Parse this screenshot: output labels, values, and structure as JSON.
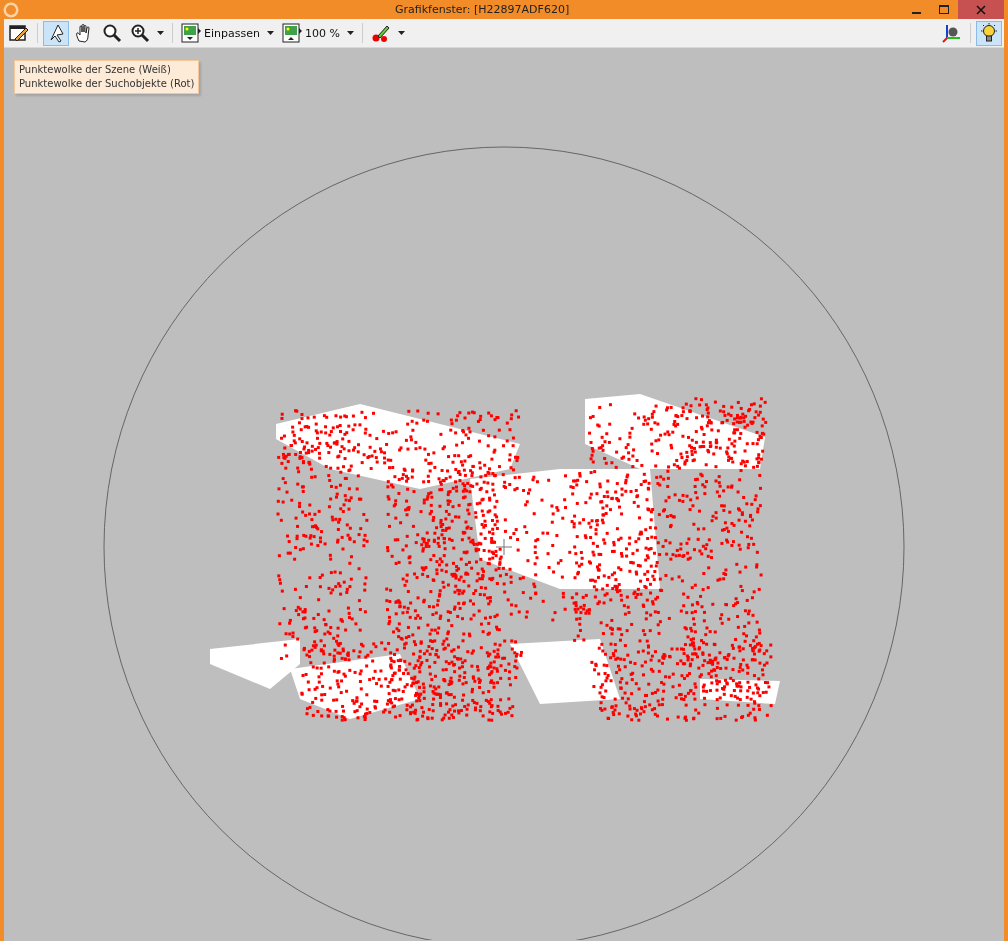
{
  "window": {
    "title": "Grafikfenster: [H22897ADF620]"
  },
  "toolbar": [
    {
      "kind": "edit",
      "selected": false,
      "dropdown": false
    },
    {
      "kind": "separator"
    },
    {
      "kind": "pointer",
      "selected": true,
      "dropdown": false
    },
    {
      "kind": "pan",
      "selected": false,
      "dropdown": false
    },
    {
      "kind": "zoom",
      "selected": false,
      "dropdown": false
    },
    {
      "kind": "zoom-in",
      "selected": false,
      "dropdown": true
    },
    {
      "kind": "separator"
    },
    {
      "kind": "fit",
      "label": "Einpassen",
      "selected": false,
      "dropdown": true
    },
    {
      "kind": "actual-size",
      "label": "100 %",
      "selected": false,
      "dropdown": true
    },
    {
      "kind": "separator"
    },
    {
      "kind": "color",
      "selected": false,
      "dropdown": true
    }
  ],
  "toolbar_right": [
    {
      "kind": "axes",
      "selected": false,
      "dropdown": false
    },
    {
      "kind": "separator"
    },
    {
      "kind": "light",
      "selected": true,
      "dropdown": false
    }
  ],
  "legend": [
    "Punktewolke der Szene (Weiß)",
    "Punktewolke der Suchobjekte (Rot)"
  ]
}
